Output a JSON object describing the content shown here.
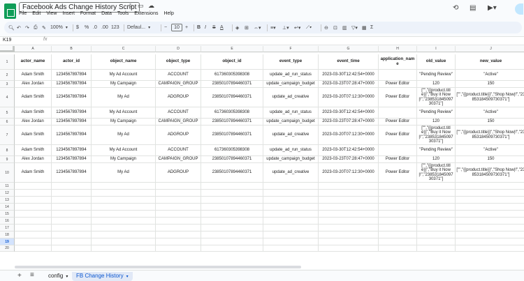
{
  "title": {
    "doc_title": "Facebook Ads Change History Script",
    "menus": [
      "File",
      "Edit",
      "View",
      "Insert",
      "Format",
      "Data",
      "Tools",
      "Extensions",
      "Help"
    ]
  },
  "toolbar": {
    "zoom": "100%",
    "currency": "$",
    "percent": "%",
    "dec_decrease": ".0",
    "dec_increase": ".00",
    "number_format": "123",
    "font": "Defaul...",
    "font_size": "10"
  },
  "formula": {
    "cell_ref": "K19",
    "fx": "fx",
    "value": ""
  },
  "grid": {
    "col_letters": [
      "A",
      "B",
      "C",
      "D",
      "E",
      "F",
      "G",
      "H",
      "I",
      "J"
    ],
    "row_numbers": [
      "1",
      "2",
      "3",
      "4",
      "5",
      "6",
      "7",
      "8",
      "9",
      "10",
      "11",
      "12",
      "13",
      "14",
      "15",
      "16",
      "17",
      "18",
      "19",
      "20"
    ],
    "active_row": "19",
    "headers": [
      "actor_name",
      "actor_id",
      "object_name",
      "object_type",
      "object_id",
      "event_type",
      "event_time",
      "application_name",
      "old_value",
      "new_value"
    ],
    "rows": [
      [
        "Adam Smith",
        "1234567897894",
        "My Ad Account",
        "ACCOUNT",
        "617360305398308",
        "update_ad_run_status",
        "2023-03-30T12:42:54+0000",
        "",
        "\"Pending Review\"",
        "\"Active\""
      ],
      [
        "Alex Jordan",
        "1234567897894",
        "My Campaign",
        "CAMPAIGN_GROUP",
        "23850107894460371",
        "update_campaign_budget",
        "2023-03-23T07:28:47+0000",
        "Power Editor",
        "120",
        "150"
      ],
      [
        "Adam Smith",
        "1234567897894",
        "My Ad",
        "ADGROUP",
        "23850107894460371",
        "update_ad_creative",
        "2023-03-20T07:12:30+0000",
        "Power Editor",
        "[\"\",\"{{product.title}}\",\"Buy it Now|!\",\"23853184509730371\"]",
        "[\"\",\"{{product.title}}\",\"Shop Now|!\",\"23853184509730371\"]"
      ],
      [
        "Adam Smith",
        "1234567897894",
        "My Ad Account",
        "ACCOUNT",
        "617360305398308",
        "update_ad_run_status",
        "2023-03-30T12:42:54+0000",
        "",
        "\"Pending Review\"",
        "\"Active\""
      ],
      [
        "Alex Jordan",
        "1234567897894",
        "My Campaign",
        "CAMPAIGN_GROUP",
        "23850107894460371",
        "update_campaign_budget",
        "2023-03-23T07:28:47+0000",
        "Power Editor",
        "120",
        "150"
      ],
      [
        "Adam Smith",
        "1234567897894",
        "My Ad",
        "ADGROUP",
        "23850107894460371",
        "update_ad_creative",
        "2023-03-20T07:12:30+0000",
        "Power Editor",
        "[\"\",\"{{product.title}}\",\"Buy it Now|!\",\"23853184509730371\"]",
        "[\"\",\"{{product.title}}\",\"Shop Now|!\",\"23853184509730371\"]"
      ],
      [
        "Adam Smith",
        "1234567897894",
        "My Ad Account",
        "ACCOUNT",
        "617360305398308",
        "update_ad_run_status",
        "2023-03-30T12:42:54+0000",
        "",
        "\"Pending Review\"",
        "\"Active\""
      ],
      [
        "Alex Jordan",
        "1234567897894",
        "My Campaign",
        "CAMPAIGN_GROUP",
        "23850107894460371",
        "update_campaign_budget",
        "2023-03-23T07:28:47+0000",
        "Power Editor",
        "120",
        "150"
      ],
      [
        "Adam Smith",
        "1234567897894",
        "My Ad",
        "ADGROUP",
        "23850107894460371",
        "update_ad_creative",
        "2023-03-20T07:12:30+0000",
        "Power Editor",
        "[\"\",\"{{product.title}}\",\"Buy it Now|!\",\"23853184509730371\"]",
        "[\"\",\"{{product.title}}\",\"Shop Now|!\",\"23853184509730371\"]"
      ]
    ]
  },
  "tabs": [
    {
      "label": "config",
      "active": false
    },
    {
      "label": "FB Change History",
      "active": true
    }
  ]
}
